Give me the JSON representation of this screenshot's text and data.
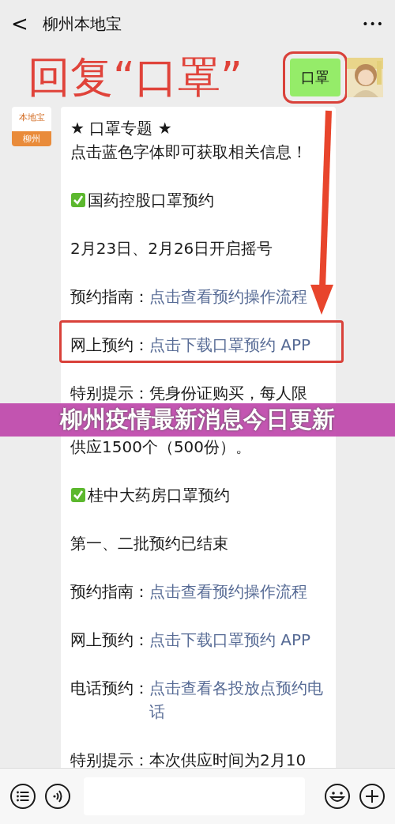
{
  "header": {
    "back": "<",
    "title": "柳州本地宝",
    "more": "•••"
  },
  "annotation": {
    "text": "回复“口罩”",
    "reply": "口罩"
  },
  "account_logo": {
    "top": "本地宝",
    "bottom": "柳州"
  },
  "message": [
    {
      "kind": "plain",
      "text": "★ 口罩专题 ★",
      "tight": true
    },
    {
      "kind": "plain",
      "text": "点击蓝色字体即可获取相关信息！"
    },
    {
      "kind": "check",
      "text": "国药控股口罩预约"
    },
    {
      "kind": "plain",
      "text": "2月23日、2月26日开启摇号"
    },
    {
      "kind": "link",
      "label": "预约指南：",
      "link": "点击查看预约操作流程"
    },
    {
      "kind": "link",
      "label": "网上预约：",
      "link": "点击下载口罩预约 APP",
      "boxed": true
    },
    {
      "kind": "plain",
      "text": "特别提示：凭身份证购买，每人限",
      "tight": true
    },
    {
      "kind": "gap"
    },
    {
      "kind": "plain",
      "text": "供应1500个（500份）。"
    },
    {
      "kind": "check",
      "text": "桂中大药房口罩预约"
    },
    {
      "kind": "plain",
      "text": "第一、二批预约已结束"
    },
    {
      "kind": "link",
      "label": "预约指南：",
      "link": "点击查看预约操作流程"
    },
    {
      "kind": "link",
      "label": "网上预约：",
      "link": "点击下载口罩预约 APP"
    },
    {
      "kind": "link",
      "label": "电话预约：",
      "link": "点击查看各投放点预约电话"
    },
    {
      "kind": "plain",
      "text": "特别提示：本次供应时间为2月10"
    }
  ],
  "banner": "柳州疫情最新消息今日更新"
}
